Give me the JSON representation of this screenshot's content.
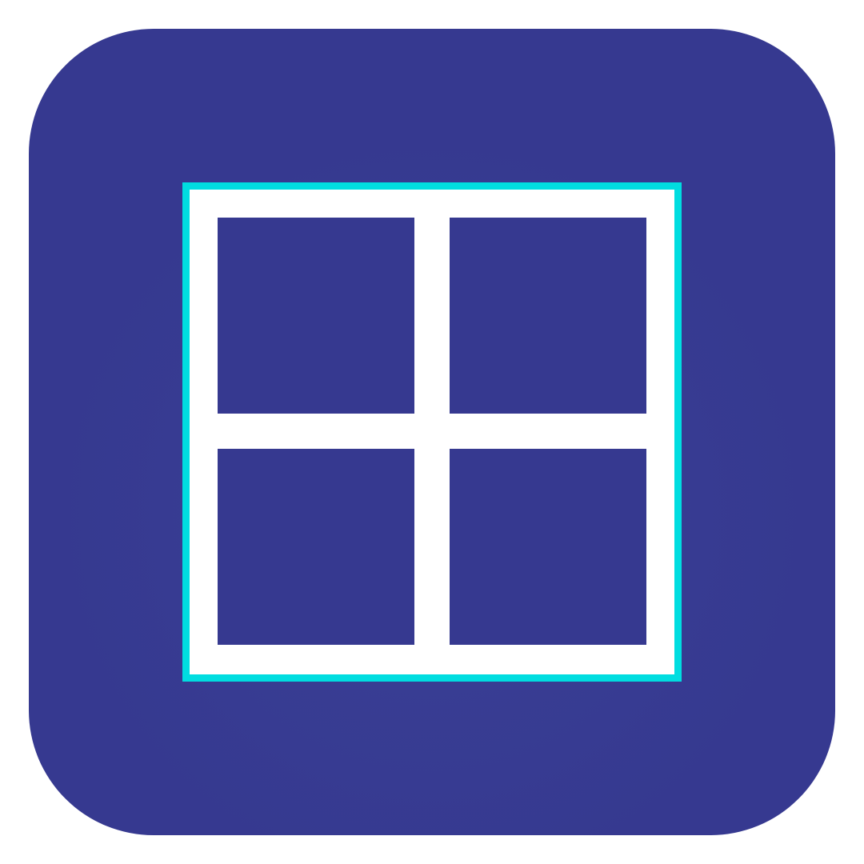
{
  "icon": {
    "name": "grid-icon",
    "colors": {
      "background": "#363990",
      "foreground": "#ffffff",
      "outline": "#00dde0"
    },
    "cells": [
      "top-left",
      "top-right",
      "bottom-left",
      "bottom-right"
    ]
  }
}
